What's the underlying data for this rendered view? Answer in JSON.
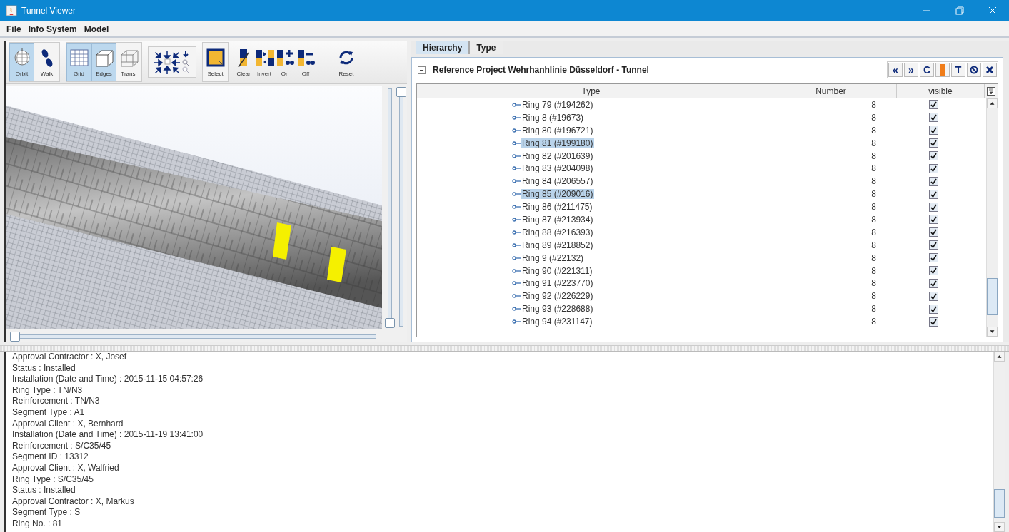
{
  "window": {
    "title": "Tunnel Viewer"
  },
  "menu": [
    {
      "label": "File"
    },
    {
      "label": "Info System"
    },
    {
      "label": "Model"
    }
  ],
  "toolbar": {
    "groups": [
      {
        "framed": true,
        "buttons": [
          {
            "kind": "orbit",
            "label": "Orbit",
            "selected": true
          },
          {
            "kind": "walk",
            "label": "Walk",
            "selected": false
          }
        ]
      },
      {
        "framed": true,
        "buttons": [
          {
            "kind": "grid",
            "label": "Grid",
            "selected": true
          },
          {
            "kind": "edges",
            "label": "Edges",
            "selected": true
          },
          {
            "kind": "trans",
            "label": "Trans.",
            "selected": false
          }
        ]
      },
      {
        "framed": true,
        "buttons": [
          {
            "kind": "navigation"
          }
        ]
      },
      {
        "framed": true,
        "buttons": [
          {
            "kind": "select",
            "label": "Select",
            "selected": false
          }
        ]
      },
      {
        "framed": false,
        "buttons": [
          {
            "kind": "clear",
            "label": "Clear",
            "selected": false
          },
          {
            "kind": "invert",
            "label": "Invert",
            "selected": false
          },
          {
            "kind": "on",
            "label": "On",
            "selected": false
          },
          {
            "kind": "off",
            "label": "Off",
            "selected": false
          },
          {
            "kind": "reset",
            "label": "Reset",
            "selected": false
          }
        ]
      }
    ]
  },
  "viewport": {
    "kind": "picture",
    "vertical_sliders": [
      {
        "level": 0
      },
      {
        "level": 1
      }
    ],
    "horizontal_slider": {
      "level": 0
    }
  },
  "tabs": [
    {
      "label": "Hierarchy",
      "selected": true
    },
    {
      "label": "Type",
      "selected": false
    }
  ],
  "tree": {
    "root": "Reference Project Wehrhanhlinie Düsseldorf - Tunnel",
    "expanded": true,
    "actions": [
      {
        "kind": "text",
        "label": "«"
      },
      {
        "kind": "text",
        "label": "»"
      },
      {
        "kind": "text",
        "label": "C"
      },
      {
        "kind": "swatch"
      },
      {
        "kind": "text",
        "label": "T"
      },
      {
        "kind": "hide"
      },
      {
        "kind": "close"
      }
    ]
  },
  "table": {
    "columns": [
      "Type",
      "Number",
      "visible"
    ],
    "rows": [
      {
        "label": "Ring 79 (#194262)",
        "number": "8",
        "visible": true,
        "selected": false
      },
      {
        "label": "Ring 8 (#19673)",
        "number": "8",
        "visible": true,
        "selected": false
      },
      {
        "label": "Ring 80 (#196721)",
        "number": "8",
        "visible": true,
        "selected": false
      },
      {
        "label": "Ring 81 (#199180)",
        "number": "8",
        "visible": true,
        "selected": true
      },
      {
        "label": "Ring 82 (#201639)",
        "number": "8",
        "visible": true,
        "selected": false
      },
      {
        "label": "Ring 83 (#204098)",
        "number": "8",
        "visible": true,
        "selected": false
      },
      {
        "label": "Ring 84 (#206557)",
        "number": "8",
        "visible": true,
        "selected": false
      },
      {
        "label": "Ring 85 (#209016)",
        "number": "8",
        "visible": true,
        "selected": true
      },
      {
        "label": "Ring 86 (#211475)",
        "number": "8",
        "visible": true,
        "selected": false
      },
      {
        "label": "Ring 87 (#213934)",
        "number": "8",
        "visible": true,
        "selected": false
      },
      {
        "label": "Ring 88 (#216393)",
        "number": "8",
        "visible": true,
        "selected": false
      },
      {
        "label": "Ring 89 (#218852)",
        "number": "8",
        "visible": true,
        "selected": false
      },
      {
        "label": "Ring 9 (#22132)",
        "number": "8",
        "visible": true,
        "selected": false
      },
      {
        "label": "Ring 90 (#221311)",
        "number": "8",
        "visible": true,
        "selected": false
      },
      {
        "label": "Ring 91 (#223770)",
        "number": "8",
        "visible": true,
        "selected": false
      },
      {
        "label": "Ring 92 (#226229)",
        "number": "8",
        "visible": true,
        "selected": false
      },
      {
        "label": "Ring 93 (#228688)",
        "number": "8",
        "visible": true,
        "selected": false
      },
      {
        "label": "Ring 94 (#231147)",
        "number": "8",
        "visible": true,
        "selected": false
      }
    ]
  },
  "details": {
    "lines": [
      "Approval Contractor : X, Josef",
      "Status : Installed",
      "Installation (Date and Time) : 2015-11-15 04:57:26",
      "Ring Type : TN/N3",
      "Reinforcement : TN/N3",
      "Segment Type : A1",
      "Approval Client : X, Bernhard",
      "Installation (Date and Time) : 2015-11-19 13:41:00",
      "Reinforcement : S/C35/45",
      "Segment ID : 13312",
      "Approval Client : X, Walfried",
      "Ring Type : S/C35/45",
      "Status : Installed",
      "Approval Contractor : X, Markus",
      "Segment Type : S",
      "Ring No. : 81"
    ]
  }
}
